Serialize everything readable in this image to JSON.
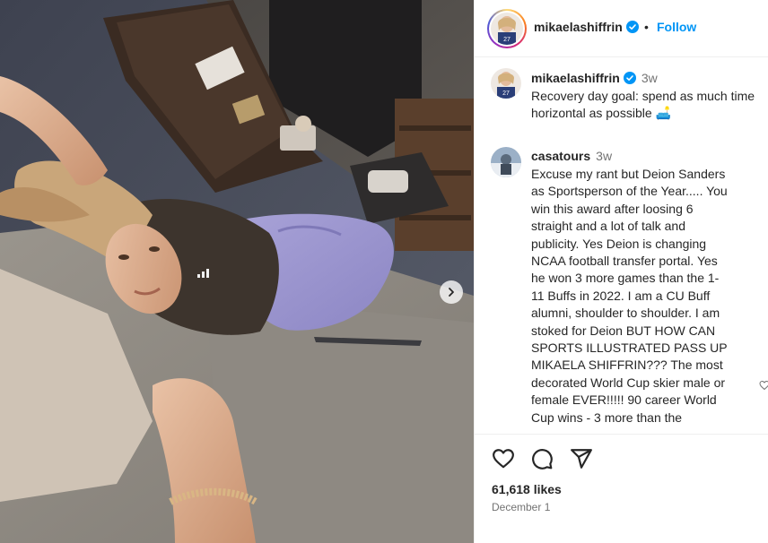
{
  "post": {
    "username": "mikaelashiffrin",
    "follow_label": "Follow",
    "separator": "•",
    "caption": {
      "username": "mikaelashiffrin",
      "time": "3w",
      "line1": "Recovery day goal: spend as much time",
      "line2": "horizontal as possible 🛋️"
    },
    "comments": [
      {
        "username": "casatours",
        "time": "3w",
        "lines": [
          "Excuse my rant but Deion Sanders",
          "as Sportsperson of the Year..... You",
          "win this award after loosing 6",
          "straight and a lot of talk and",
          "publicity. Yes Deion is changing",
          "NCAA football transfer portal. Yes",
          "he won 3 more games than the 1-",
          "11 Buffs in 2022. I am a CU Buff",
          "alumni, shoulder to shoulder. I am",
          "stoked for Deion BUT HOW CAN",
          "SPORTS ILLUSTRATED PASS UP",
          "MIKAELA SHIFFRIN??? The most",
          "decorated World Cup skier male or",
          "female EVER!!!!! 90 career World",
          "Cup wins - 3 more than the"
        ]
      }
    ],
    "likes": "61,618 likes",
    "date": "December 1",
    "icons": {
      "like": "heart-icon",
      "comment": "comment-icon",
      "share": "share-icon",
      "next": "chevron-right-icon",
      "verified": "verified-badge-icon"
    },
    "colors": {
      "accent": "#0095f6",
      "verified": "#0095f6",
      "text": "#262626",
      "muted": "#737373"
    }
  }
}
